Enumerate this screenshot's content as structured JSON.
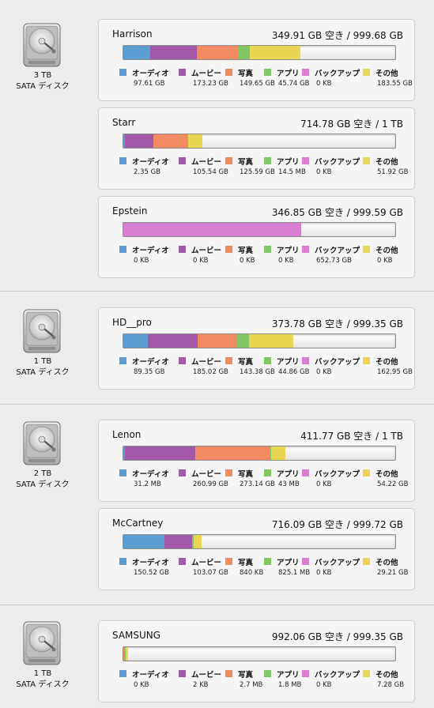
{
  "colors": {
    "audio": "#5b9dd3",
    "movies": "#a05aa8",
    "photos": "#f38b62",
    "apps": "#82c766",
    "backups": "#d97fd2",
    "other": "#e9d653"
  },
  "legend_labels": [
    "オーディオ",
    "ムービー",
    "写真",
    "アプリ",
    "バックアップ",
    "その他"
  ],
  "disks": [
    {
      "capacity": "3 TB",
      "type": "SATA ディスク",
      "volumes": [
        {
          "name": "Harrison",
          "space": "349.91 GB 空き / 999.68 GB",
          "usage": [
            97.61,
            173.23,
            149.65,
            45.74,
            0,
            183.55
          ],
          "total": 999.68,
          "values": [
            "97.61 GB",
            "173.23 GB",
            "149.65 GB",
            "45.74 GB",
            "0 KB",
            "183.55 GB"
          ]
        },
        {
          "name": "Starr",
          "space": "714.78 GB 空き / 1 TB",
          "usage": [
            2.35,
            105.54,
            125.59,
            0.0145,
            0,
            51.92
          ],
          "total": 1000,
          "values": [
            "2.35 GB",
            "105.54 GB",
            "125.59 GB",
            "14.5 MB",
            "0 KB",
            "51.92 GB"
          ]
        },
        {
          "name": "Epstein",
          "space": "346.85 GB 空き / 999.59 GB",
          "usage": [
            0,
            0,
            0,
            0,
            652.73,
            0
          ],
          "total": 999.59,
          "values": [
            "0 KB",
            "0 KB",
            "0 KB",
            "0 KB",
            "652.73 GB",
            "0 KB"
          ]
        }
      ]
    },
    {
      "capacity": "1 TB",
      "type": "SATA ディスク",
      "volumes": [
        {
          "name": "HD__pro",
          "space": "373.78 GB 空き / 999.35 GB",
          "usage": [
            89.35,
            185.02,
            143.38,
            44.86,
            0,
            162.95
          ],
          "total": 999.35,
          "values": [
            "89.35 GB",
            "185.02 GB",
            "143.38 GB",
            "44.86 GB",
            "0 KB",
            "162.95 GB"
          ]
        }
      ]
    },
    {
      "capacity": "2 TB",
      "type": "SATA ディスク",
      "volumes": [
        {
          "name": "Lenon",
          "space": "411.77 GB 空き / 1 TB",
          "usage": [
            0.0312,
            260.99,
            273.14,
            0.043,
            0,
            54.22
          ],
          "total": 1000,
          "values": [
            "31.2 MB",
            "260.99 GB",
            "273.14 GB",
            "43 MB",
            "0 KB",
            "54.22 GB"
          ]
        },
        {
          "name": "McCartney",
          "space": "716.09 GB 空き / 999.72 GB",
          "usage": [
            150.52,
            103.07,
            0.00084,
            0.8251,
            0,
            29.21
          ],
          "total": 999.72,
          "values": [
            "150.52 GB",
            "103.07 GB",
            "840 KB",
            "825.1 MB",
            "0 KB",
            "29.21 GB"
          ]
        }
      ]
    },
    {
      "capacity": "1 TB",
      "type": "SATA ディスク",
      "volumes": [
        {
          "name": "SAMSUNG",
          "space": "992.06 GB 空き / 999.35 GB",
          "usage": [
            0,
            2e-06,
            0.0027,
            0.0018,
            0,
            7.28
          ],
          "total": 999.35,
          "values": [
            "0 KB",
            "2 KB",
            "2.7 MB",
            "1.8 MB",
            "0 KB",
            "7.28 GB"
          ]
        }
      ]
    }
  ]
}
